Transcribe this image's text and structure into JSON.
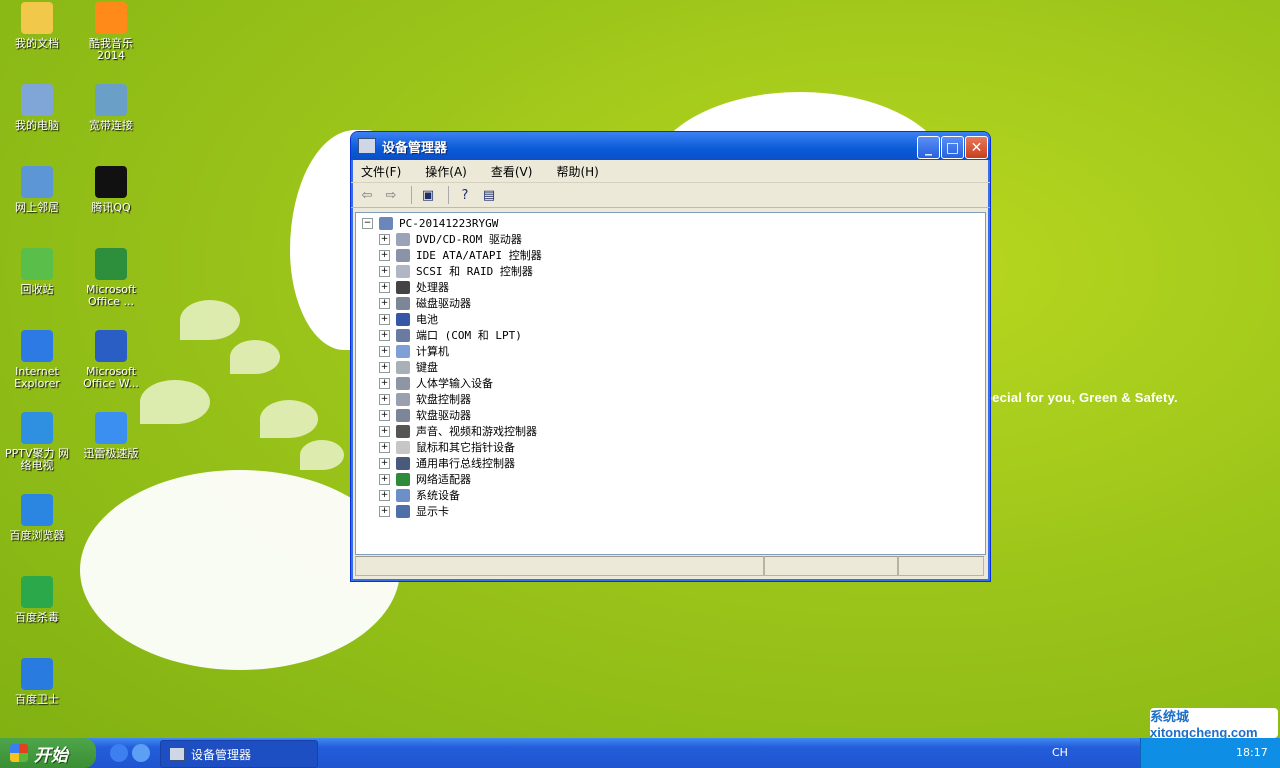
{
  "desktop": {
    "icons": [
      {
        "label": "我的文档",
        "color": "#f2c84b"
      },
      {
        "label": "酷我音乐\n2014",
        "color": "#ff8a1a"
      },
      {
        "label": "我的电脑",
        "color": "#7fa6d6"
      },
      {
        "label": "宽带连接",
        "color": "#6aa0c8"
      },
      {
        "label": "网上邻居",
        "color": "#5c96d6"
      },
      {
        "label": "腾讯QQ",
        "color": "#111111"
      },
      {
        "label": "回收站",
        "color": "#5abf4a"
      },
      {
        "label": "Microsoft\nOffice ...",
        "color": "#2d8f3b"
      },
      {
        "label": "Internet\nExplorer",
        "color": "#2e7ae4"
      },
      {
        "label": "Microsoft\nOffice W...",
        "color": "#2b5ec4"
      },
      {
        "label": "PPTV聚力 网\n络电视",
        "color": "#2f8fe0"
      },
      {
        "label": "迅雷极速版",
        "color": "#3b8ff0"
      },
      {
        "label": "百度浏览器",
        "color": "#2a86e0"
      },
      {
        "label": "百度杀毒",
        "color": "#2aa84a"
      },
      {
        "label": "百度卫士",
        "color": "#2a7be0"
      }
    ],
    "slogan": "pecial for you, Green & Safety.",
    "watermark": "系统城 xitongcheng.com"
  },
  "window": {
    "title": "设备管理器",
    "menus": [
      "文件(F)",
      "操作(A)",
      "查看(V)",
      "帮助(H)"
    ],
    "toolbar_icons": [
      "back-arrow-icon",
      "forward-arrow-icon",
      "show-hide-tree-icon",
      "help-icon",
      "properties-icon"
    ],
    "tree": {
      "root": "PC-20141223RYGW",
      "children": [
        "DVD/CD-ROM 驱动器",
        "IDE ATA/ATAPI 控制器",
        "SCSI 和 RAID 控制器",
        "处理器",
        "磁盘驱动器",
        "电池",
        "端口 (COM 和 LPT)",
        "计算机",
        "键盘",
        "人体学输入设备",
        "软盘控制器",
        "软盘驱动器",
        "声音、视频和游戏控制器",
        "鼠标和其它指针设备",
        "通用串行总线控制器",
        "网络适配器",
        "系统设备",
        "显示卡"
      ]
    }
  },
  "taskbar": {
    "start_label": "开始",
    "task_label": "设备管理器",
    "language": "CH",
    "clock": "18:17"
  }
}
